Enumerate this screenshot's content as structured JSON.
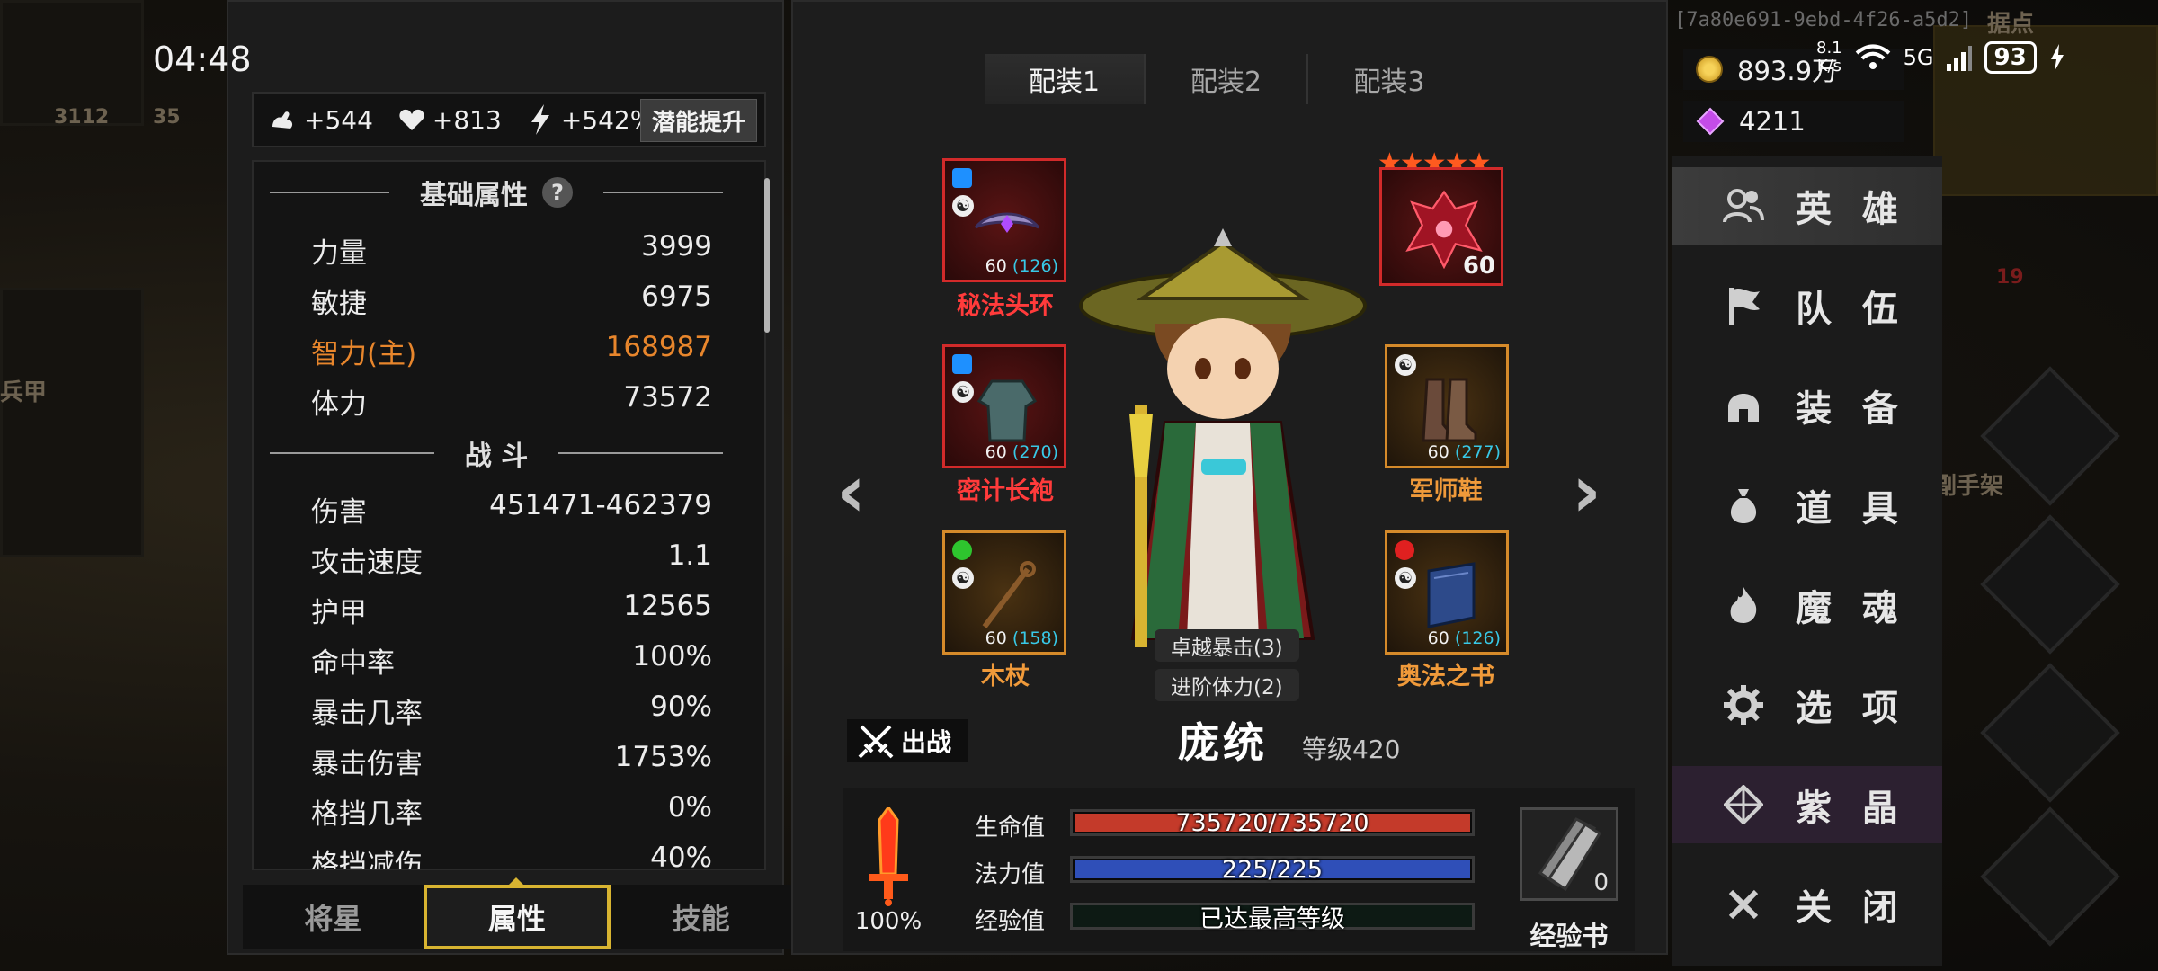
{
  "status": {
    "time": "04:48",
    "session_id": "[7a80e691-9ebd-4f26-a5d2]",
    "net_speed": "8.1\nK/s",
    "network": "5G",
    "battery": "93"
  },
  "background": {
    "left_label": "兵甲",
    "map_label": "据点",
    "map_badge": "19",
    "side_label": "副手架",
    "bottom_left_a": "3112",
    "bottom_left_b": "35"
  },
  "left_panel": {
    "bonuses": [
      {
        "icon": "strength-arm-icon",
        "value": "+544"
      },
      {
        "icon": "heart-icon",
        "value": "+813"
      },
      {
        "icon": "lightning-icon",
        "value": "+542%"
      }
    ],
    "potential_button": "潜能提升",
    "basic_section_title": "基础属性",
    "help_symbol": "?",
    "basic_attrs": [
      {
        "label": "力量",
        "value": "3999"
      },
      {
        "label": "敏捷",
        "value": "6975"
      },
      {
        "label": "智力(主)",
        "value": "168987"
      },
      {
        "label": "体力",
        "value": "73572"
      }
    ],
    "combat_section_title": "战 斗",
    "combat_attrs": [
      {
        "label": "伤害",
        "value": "451471-462379"
      },
      {
        "label": "攻击速度",
        "value": "1.1"
      },
      {
        "label": "护甲",
        "value": "12565"
      },
      {
        "label": "命中率",
        "value": "100%"
      },
      {
        "label": "暴击几率",
        "value": "90%"
      },
      {
        "label": "暴击伤害",
        "value": "1753%"
      },
      {
        "label": "格挡几率",
        "value": "0%"
      },
      {
        "label": "格挡减伤",
        "value": "40%"
      }
    ],
    "tabs": [
      "将星",
      "属性",
      "技能"
    ],
    "active_tab": "属性"
  },
  "center": {
    "loadout_tabs": [
      "配装1",
      "配装2",
      "配装3"
    ],
    "active_loadout": "配装1",
    "prev_arrow": "‹",
    "next_arrow": "›",
    "equipment": [
      {
        "name": "秘法头环",
        "level": "60",
        "extra": "(126)",
        "gem_color": "#1e90ff",
        "rarity": "red"
      },
      {
        "name": "密计长袍",
        "level": "60",
        "extra": "(270)",
        "gem_color": "#1e90ff",
        "rarity": "red"
      },
      {
        "name": "木杖",
        "level": "60",
        "extra": "(158)",
        "gem_color": "#2ec52e",
        "rarity": "orange"
      },
      {
        "name": "军师鞋",
        "level": "60",
        "extra": "(277)",
        "gem_color": "",
        "rarity": "orange"
      },
      {
        "name": "奥法之书",
        "level": "60",
        "extra": "(126)",
        "gem_color": "#e02020",
        "rarity": "orange"
      }
    ],
    "pet": {
      "level": "60",
      "stars": 5
    },
    "hero_tags": [
      "卓越暴击(3)",
      "进阶体力(2)"
    ],
    "sortie_label": "出战",
    "hero_name": "庞统",
    "hero_level": "等级420",
    "morale_pct": "100%",
    "vitals": {
      "hp_label": "生命值",
      "hp_text": "735720/735720",
      "hp_fraction": 1.0,
      "mp_label": "法力值",
      "mp_text": "225/225",
      "mp_fraction": 1.0,
      "exp_label": "经验值",
      "exp_text": "已达最高等级",
      "exp_fraction": 0.0
    },
    "exp_book_label": "经验书",
    "exp_book_count": "0"
  },
  "currency": {
    "gold": "893.9万",
    "gems": "4211"
  },
  "right_menu": [
    {
      "label": "英 雄",
      "icon": "heroes-icon",
      "active": true
    },
    {
      "label": "队 伍",
      "icon": "flag-icon",
      "active": false
    },
    {
      "label": "装 备",
      "icon": "helmet-icon",
      "active": false
    },
    {
      "label": "道 具",
      "icon": "bag-icon",
      "active": false
    },
    {
      "label": "魔 魂",
      "icon": "flame-icon",
      "active": false
    },
    {
      "label": "选 项",
      "icon": "gear-icon",
      "active": false
    },
    {
      "label": "紫 晶",
      "icon": "crystal-icon",
      "active": false
    },
    {
      "label": "关 闭",
      "icon": "close-icon",
      "active": false
    }
  ],
  "colors": {
    "accent_gold": "#d8b431",
    "primary_attr": "#e8862c",
    "hp_bar": "#c43a2a",
    "mp_bar": "#2f4fb8",
    "equip_red": "#ff3b3b",
    "equip_orange": "#f09a3a"
  }
}
